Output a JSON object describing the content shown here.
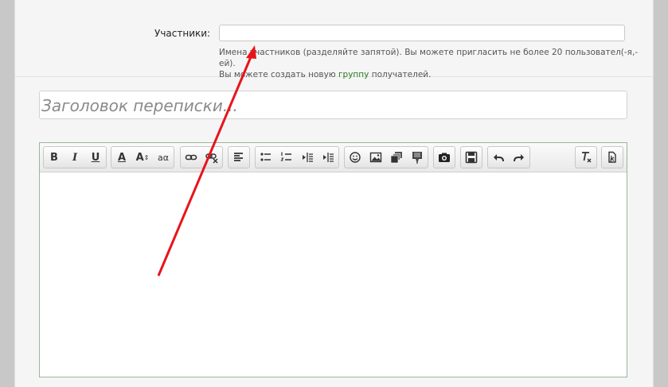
{
  "recipients": {
    "label": "Участники:",
    "value": "",
    "hint_line1": "Имена участников (разделяйте запятой). Вы можете пригласить не более 20 пользовател(-я,-ей).",
    "hint_line2_before": "Вы можете создать новую",
    "hint_link": "группу",
    "hint_line2_after": "получателей."
  },
  "title_field": {
    "placeholder": "Заголовок переписки..."
  },
  "toolbar": {
    "bold": "B",
    "italic": "I",
    "underline": "U",
    "font_color": "A",
    "font_size": "A",
    "font_case": "aα"
  },
  "colors": {
    "accent": "#2a7a1f",
    "arrow": "#e8141b",
    "editor_border": "#9db39d"
  }
}
